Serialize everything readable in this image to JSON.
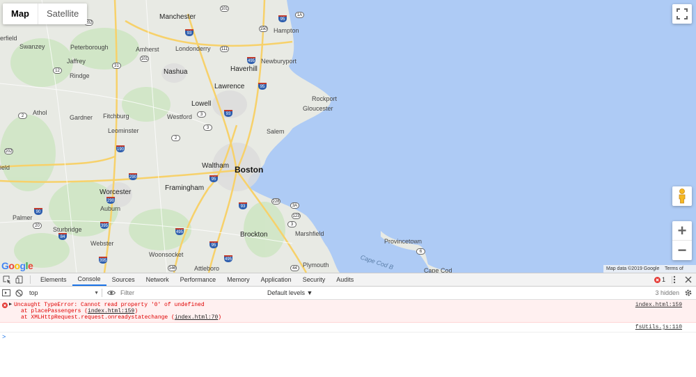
{
  "map": {
    "type_buttons": [
      "Map",
      "Satellite"
    ],
    "places": [
      {
        "name": "Manchester"
      },
      {
        "name": "Hampton"
      },
      {
        "name": "Swanzey"
      },
      {
        "name": "Peterborough"
      },
      {
        "name": "Amherst"
      },
      {
        "name": "Londonderry"
      },
      {
        "name": "Newburyport"
      },
      {
        "name": "Jaffrey"
      },
      {
        "name": "Rindge"
      },
      {
        "name": "Nashua"
      },
      {
        "name": "Haverhill"
      },
      {
        "name": "Lawrence"
      },
      {
        "name": "Rockport"
      },
      {
        "name": "Lowell"
      },
      {
        "name": "Gloucester"
      },
      {
        "name": "Athol"
      },
      {
        "name": "Gardner"
      },
      {
        "name": "Fitchburg"
      },
      {
        "name": "Westford"
      },
      {
        "name": "Leominster"
      },
      {
        "name": "Salem"
      },
      {
        "name": "Waltham"
      },
      {
        "name": "Boston"
      },
      {
        "name": "Worcester"
      },
      {
        "name": "Framingham"
      },
      {
        "name": "Auburn"
      },
      {
        "name": "Palmer"
      },
      {
        "name": "Sturbridge"
      },
      {
        "name": "Marshfield"
      },
      {
        "name": "Webster"
      },
      {
        "name": "Brockton"
      },
      {
        "name": "Provincetown"
      },
      {
        "name": "Woonsocket"
      },
      {
        "name": "Attleboro"
      },
      {
        "name": "Plymouth"
      },
      {
        "name": "Cape Cod"
      },
      {
        "name": "Cape Cod B"
      },
      {
        "name": "erfield"
      },
      {
        "name": "ield"
      }
    ],
    "shields": [
      {
        "num": "101"
      },
      {
        "num": "1A"
      },
      {
        "num": "202"
      },
      {
        "num": "95"
      },
      {
        "num": "93"
      },
      {
        "num": "150"
      },
      {
        "num": "111"
      },
      {
        "num": "31"
      },
      {
        "num": "101"
      },
      {
        "num": "12"
      },
      {
        "num": "495"
      },
      {
        "num": "95"
      },
      {
        "num": "3"
      },
      {
        "num": "93"
      },
      {
        "num": "3"
      },
      {
        "num": "2"
      },
      {
        "num": "2"
      },
      {
        "num": "202"
      },
      {
        "num": "190"
      },
      {
        "num": "290"
      },
      {
        "num": "95"
      },
      {
        "num": "290"
      },
      {
        "num": "90"
      },
      {
        "num": "20"
      },
      {
        "num": "84"
      },
      {
        "num": "395"
      },
      {
        "num": "228"
      },
      {
        "num": "3A"
      },
      {
        "num": "123"
      },
      {
        "num": "3"
      },
      {
        "num": "495"
      },
      {
        "num": "95"
      },
      {
        "num": "495"
      },
      {
        "num": "93"
      },
      {
        "num": "395"
      },
      {
        "num": "146"
      },
      {
        "num": "44"
      },
      {
        "num": "6"
      }
    ],
    "google_logo": [
      "G",
      "o",
      "o",
      "g",
      "l",
      "e"
    ],
    "logo_colors": [
      "#4285f4",
      "#ea4335",
      "#fbbc05",
      "#4285f4",
      "#34a853",
      "#ea4335"
    ],
    "attribution": "Map data ©2019 Google",
    "terms": "Terms of Use",
    "controls": {
      "fullscreen": "fullscreen-icon",
      "pegman": "pegman-icon",
      "zoom_in": "+",
      "zoom_out": "−"
    }
  },
  "devtools": {
    "tabs": [
      "Elements",
      "Console",
      "Sources",
      "Network",
      "Performance",
      "Memory",
      "Application",
      "Security",
      "Audits"
    ],
    "active_tab": "Console",
    "error_count": "1",
    "context": "top",
    "filter_placeholder": "Filter",
    "levels": "Default levels ▼",
    "hidden": "3 hidden",
    "messages": [
      {
        "text": "Uncaught TypeError: Cannot read property '0' of undefined",
        "source": "index.html:159",
        "stack": [
          {
            "prefix": "at placePassengers (",
            "link": "index.html:159",
            "suffix": ")"
          },
          {
            "prefix": "at XMLHttpRequest.request.onreadystatechange (",
            "link": "index.html:70",
            "suffix": ")"
          }
        ]
      }
    ],
    "log_source": "fsUtils.js:110",
    "prompt": ">"
  }
}
